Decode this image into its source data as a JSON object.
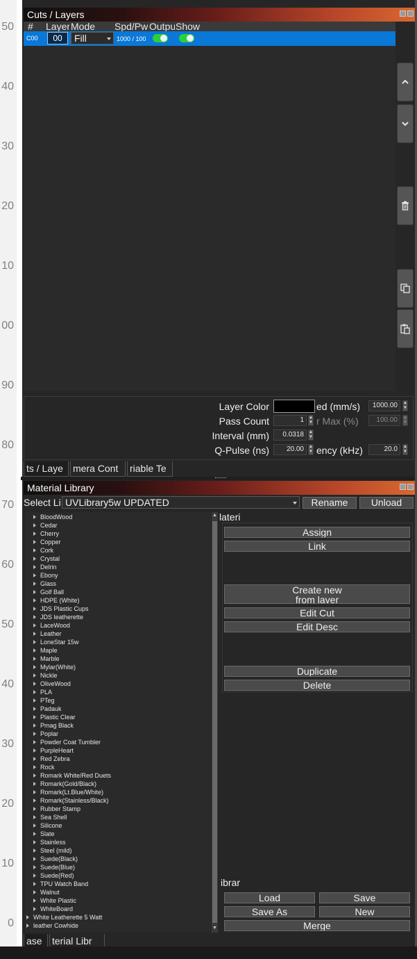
{
  "ruler": {
    "ticks": [
      "50",
      "40",
      "30",
      "20",
      "10",
      "00",
      "90",
      "80",
      "70",
      "60",
      "50",
      "40",
      "30",
      "20",
      "10",
      "0"
    ]
  },
  "cuts_panel": {
    "title": "Cuts / Layers",
    "headers": [
      "#",
      "Layer",
      "Mode",
      "Spd/Pwr",
      "Output",
      "Show"
    ],
    "row": {
      "id": "C00",
      "layer": "00",
      "mode": "Fill",
      "spd_pwr": "1000 / 100",
      "output": true,
      "show": true
    },
    "side_buttons": [
      "chevron-up-icon",
      "chevron-down-icon",
      "trash-icon",
      "copy-icon",
      "paste-icon"
    ],
    "props": {
      "layer_color_label": "Layer Color",
      "layer_color": "#000000",
      "pass_count_label": "Pass Count",
      "pass_count": "1",
      "interval_label": "Interval (mm)",
      "interval": "0.0318",
      "qpulse_label": "Q-Pulse (ns)",
      "qpulse": "20.00",
      "speed_label": "ed (mm/s)",
      "speed": "1000.00",
      "max_label": "r Max (%)",
      "max": "100.00",
      "freq_label": "ency (kHz)",
      "freq": "20.0"
    },
    "tabs": [
      "ts / Laye",
      "mera Cont",
      "riable Te"
    ]
  },
  "material_panel": {
    "title": "Material Library",
    "select_label": "Select Li",
    "library": "UVLibrary5w UPDATED",
    "rename": "Rename",
    "unload": "Unload",
    "material_label": "lateri",
    "buttons": {
      "assign": "Assign",
      "link": "Link",
      "create_line1": "Create new",
      "create_line2": "from layer",
      "edit_cut": "Edit Cut",
      "edit_desc": "Edit Desc",
      "duplicate": "Duplicate",
      "delete": "Delete"
    },
    "library_label": "ibrar",
    "lib_buttons": {
      "load": "Load",
      "save": "Save",
      "save_as": "Save As",
      "new": "New",
      "merge": "Merge"
    },
    "items": [
      "BloodWood",
      "Cedar",
      "Cherry",
      "Copper",
      "Cork",
      "Crystal",
      "Delrin",
      "Ebony",
      "Glass",
      "Golf Ball",
      "HDPE (White)",
      "JDS Plastic Cups",
      "JDS leatherette",
      "LaceWood",
      "Leather",
      "LoneStar 15w",
      "Maple",
      "Marble",
      "Mylar(White)",
      "Nickle",
      "OliveWood",
      "PLA",
      "PTeg",
      "Padauk",
      "Plastic Clear",
      "Pmag Black",
      "Poplar",
      "Powder Coat Tumbler",
      "PurpleHeart",
      "Red Zebra",
      "Rock",
      "Romark White/Red Duets",
      "Romark(Gold/Black)",
      "Romark(Lt.Blue/White)",
      "Romark(Stainless/Black)",
      "Rubber Stamp",
      "Sea Shell",
      "Silicone",
      "Slate",
      "Stainless",
      "Steel (mild)",
      "Suede(Black)",
      "Suede(Blue)",
      "Suede(Red)",
      "TPU Watch Band",
      "Walnut",
      "White Plastic",
      "WhiteBoard"
    ],
    "root_items": [
      "White Leatherette 5 Watt",
      "leather Cowhide"
    ],
    "tabs": [
      "ase",
      "terial Libr"
    ]
  }
}
